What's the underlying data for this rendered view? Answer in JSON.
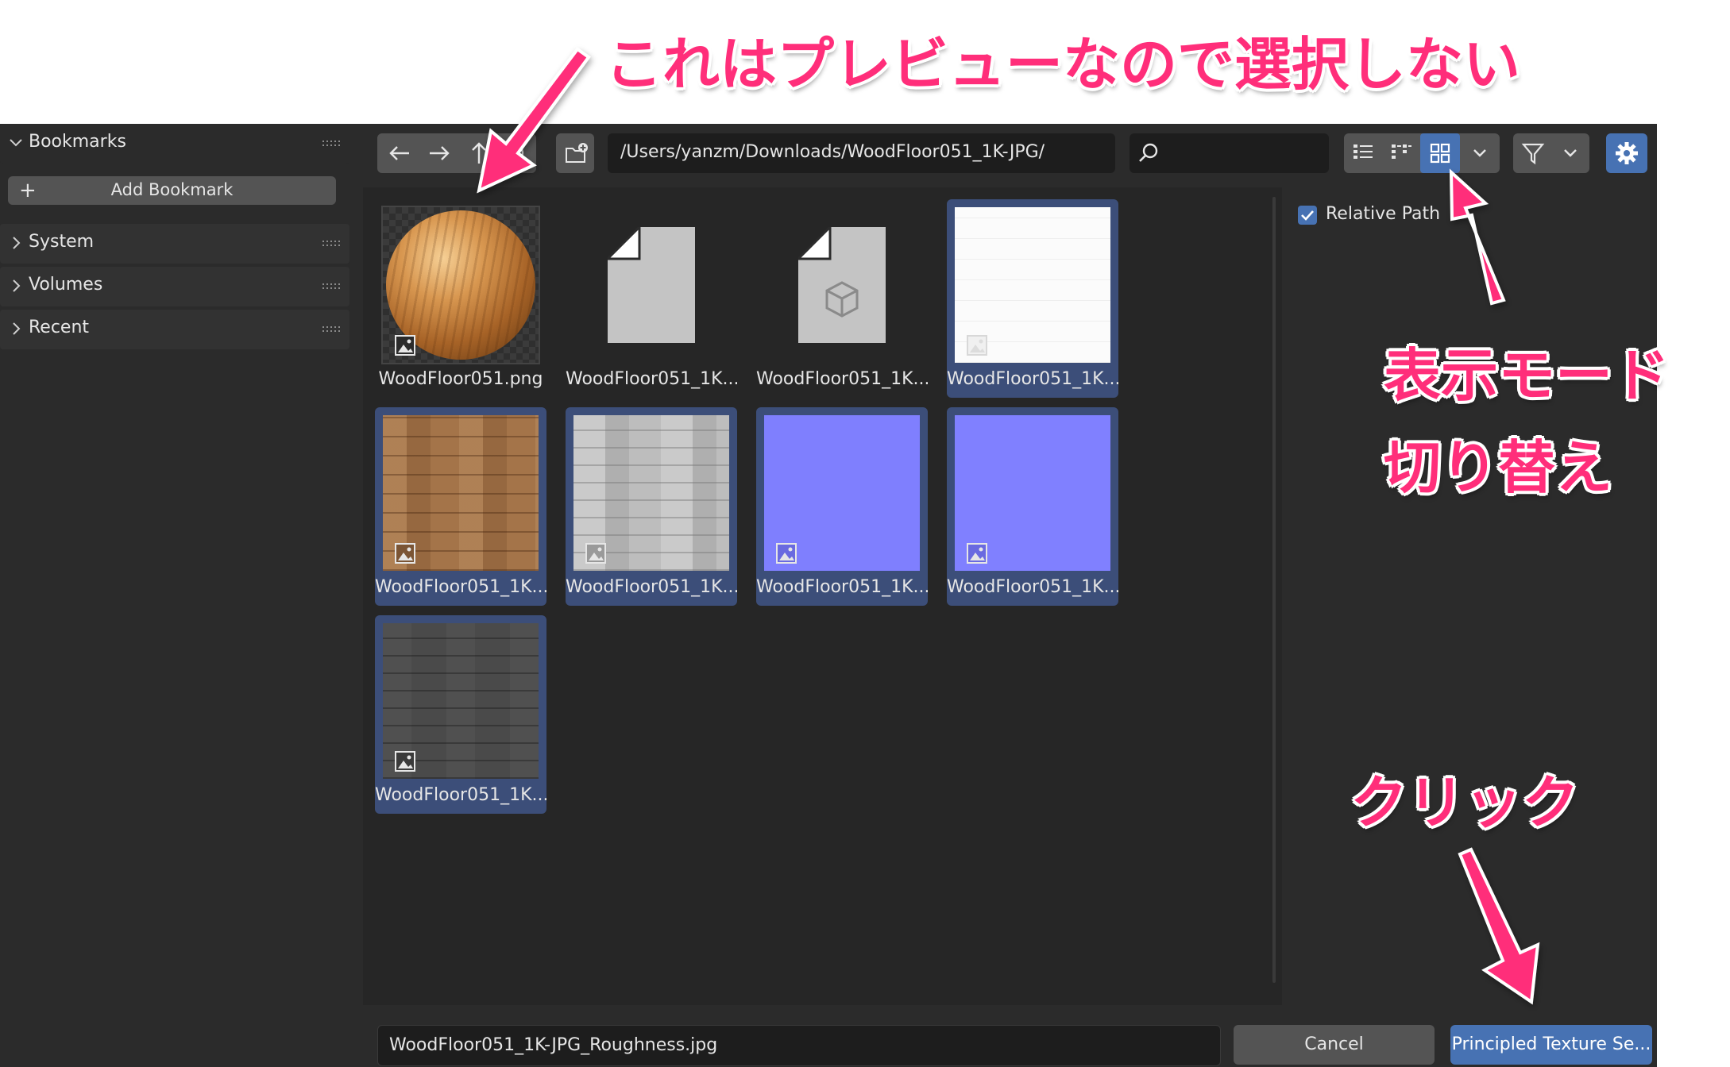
{
  "sidebar": {
    "bookmarks_label": "Bookmarks",
    "add_bookmark_label": "Add Bookmark",
    "sections": [
      {
        "label": "System"
      },
      {
        "label": "Volumes"
      },
      {
        "label": "Recent"
      }
    ]
  },
  "toolbar": {
    "path": "/Users/yanzm/Downloads/WoodFloor051_1K-JPG/",
    "search_placeholder": "",
    "display_mode_active": "thumbnails",
    "accent_color": "#4772b3"
  },
  "files": [
    {
      "name": "WoodFloor051.png",
      "kind": "sphere-preview",
      "selected": false
    },
    {
      "name": "WoodFloor051_1K...",
      "kind": "file",
      "selected": false
    },
    {
      "name": "WoodFloor051_1K...",
      "kind": "file-3d",
      "selected": false
    },
    {
      "name": "WoodFloor051_1K...",
      "kind": "white",
      "selected": true
    },
    {
      "name": "WoodFloor051_1K...",
      "kind": "wood-color",
      "selected": true
    },
    {
      "name": "WoodFloor051_1K...",
      "kind": "gray-light",
      "selected": true
    },
    {
      "name": "WoodFloor051_1K...",
      "kind": "normal",
      "selected": true
    },
    {
      "name": "WoodFloor051_1K...",
      "kind": "normal",
      "selected": true
    },
    {
      "name": "WoodFloor051_1K...",
      "kind": "gray-dark",
      "selected": true
    }
  ],
  "options": {
    "relative_path_label": "Relative Path",
    "relative_path_checked": true
  },
  "footer": {
    "filename": "WoodFloor051_1K-JPG_Roughness.jpg",
    "cancel_label": "Cancel",
    "confirm_label": "Principled Texture Se..."
  },
  "annotations": {
    "preview_note": "これはプレビューなので選択しない",
    "display_mode_line1": "表示モード",
    "display_mode_line2": "切り替え",
    "click_note": "クリック",
    "color": "#ff2e7a"
  }
}
